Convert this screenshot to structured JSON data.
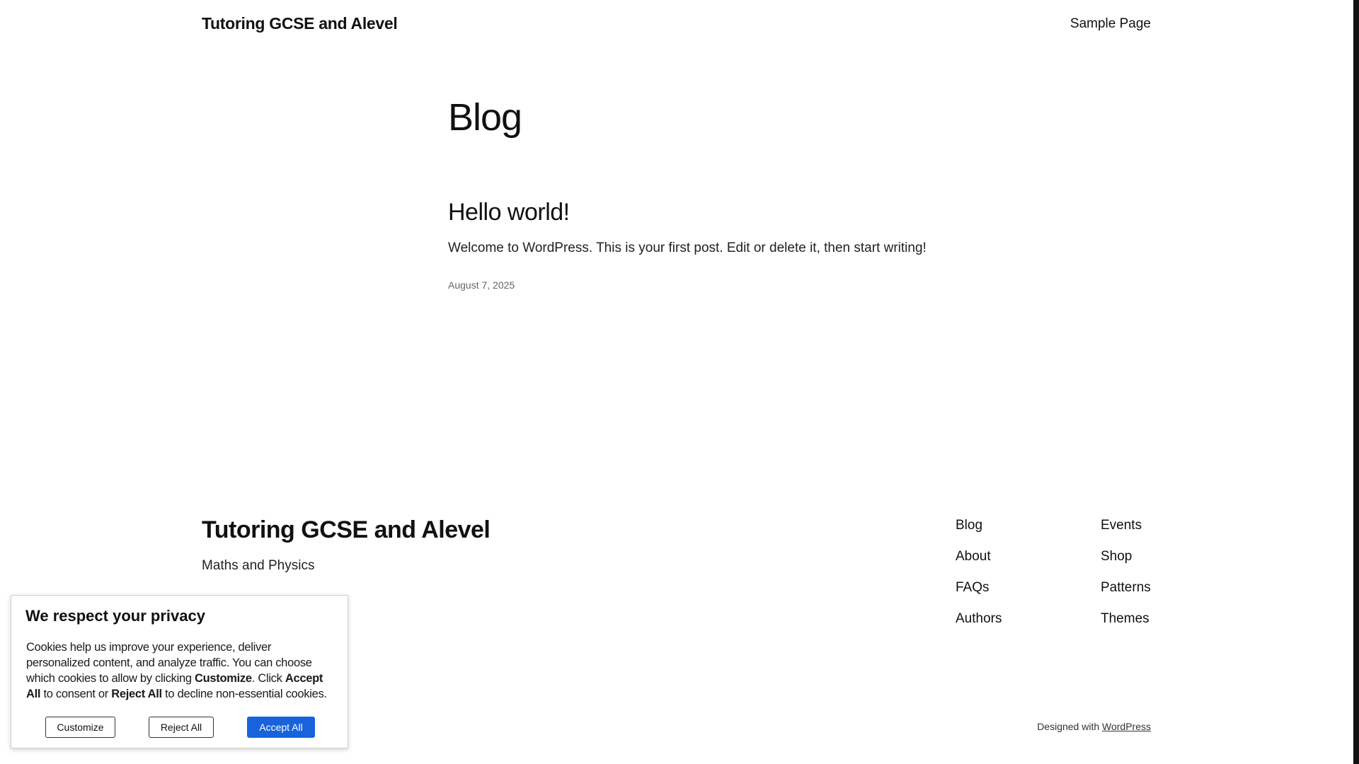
{
  "header": {
    "site_title": "Tutoring GCSE and Alevel",
    "nav": [
      "Sample Page"
    ]
  },
  "main": {
    "heading": "Blog",
    "posts": [
      {
        "title": "Hello world!",
        "excerpt": "Welcome to WordPress. This is your first post. Edit or delete it, then start writing!",
        "date": "August 7, 2025"
      }
    ]
  },
  "footer": {
    "site_title": "Tutoring GCSE and Alevel",
    "tagline": "Maths and Physics",
    "nav_col_1": [
      "Blog",
      "About",
      "FAQs",
      "Authors"
    ],
    "nav_col_2": [
      "Events",
      "Shop",
      "Patterns",
      "Themes"
    ],
    "credit_prefix": "Designed with ",
    "credit_link": "WordPress"
  },
  "cookie_banner": {
    "heading": "We respect your privacy",
    "text_part_1": "Cookies help us improve your experience, deliver personalized content, and analyze traffic. You can choose which cookies to allow by clicking ",
    "text_bold_1": "Customize",
    "text_part_2": ". Click ",
    "text_bold_2": "Accept All",
    "text_part_3": " to consent or ",
    "text_bold_3": "Reject All",
    "text_part_4": " to decline non-essential cookies.",
    "customize_label": "Customize",
    "reject_label": "Reject All",
    "accept_label": "Accept All",
    "accept_color": "#1863dc"
  }
}
